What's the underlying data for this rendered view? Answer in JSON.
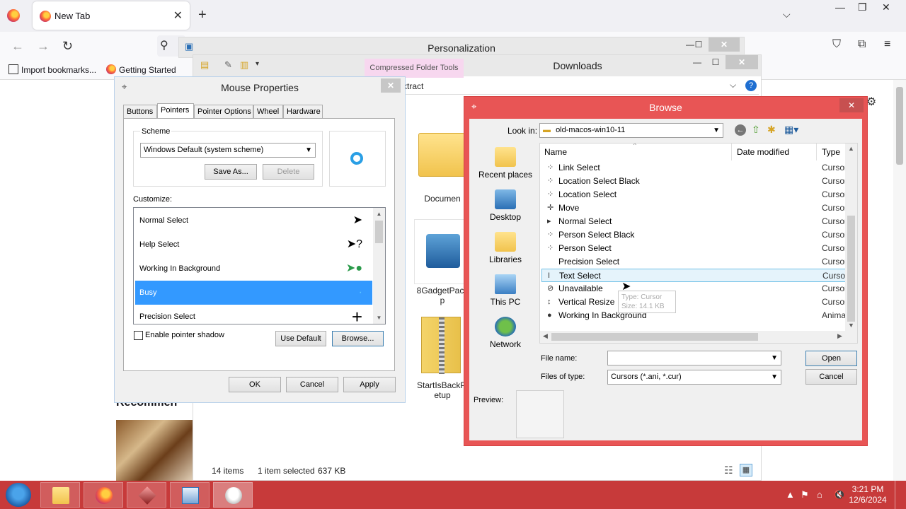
{
  "firefox": {
    "tab_title": "New Tab",
    "new_tab_glyph": "+",
    "bookmarks": [
      "Import bookmarks...",
      "Getting Started"
    ]
  },
  "webpage": {
    "section_heading": "Recommen"
  },
  "personalization": {
    "title": "Personalization"
  },
  "downloads": {
    "title": "Downloads",
    "context_tab": "Compressed Folder Tools",
    "address_text": "xtract",
    "files": [
      {
        "label": "Documen"
      },
      {
        "label": "8GadgetPack\np"
      },
      {
        "label": "StartIsBackPl\netup"
      }
    ],
    "status_items": "14 items",
    "status_selected": "1 item selected",
    "status_size": "637 KB"
  },
  "mouse_properties": {
    "title": "Mouse Properties",
    "tabs": [
      "Buttons",
      "Pointers",
      "Pointer Options",
      "Wheel",
      "Hardware"
    ],
    "active_tab": "Pointers",
    "scheme_label": "Scheme",
    "scheme_value": "Windows Default (system scheme)",
    "save_as": "Save As...",
    "delete": "Delete",
    "customize_label": "Customize:",
    "cursors": [
      {
        "name": "Normal Select",
        "glyph": "🡥"
      },
      {
        "name": "Help Select",
        "glyph": "?"
      },
      {
        "name": "Working In Background",
        "glyph": "●"
      },
      {
        "name": "Busy",
        "glyph": "·"
      },
      {
        "name": "Precision Select",
        "glyph": "+"
      }
    ],
    "selected_cursor": "Busy",
    "enable_shadow": "Enable pointer shadow",
    "use_default": "Use Default",
    "browse": "Browse...",
    "ok": "OK",
    "cancel": "Cancel",
    "apply": "Apply"
  },
  "browse_dialog": {
    "title": "Browse",
    "look_in_label": "Look in:",
    "look_in_value": "old-macos-win10-11",
    "places": [
      "Recent places",
      "Desktop",
      "Libraries",
      "This PC",
      "Network"
    ],
    "columns": {
      "name": "Name",
      "date": "Date modified",
      "type": "Type"
    },
    "files": [
      {
        "name": "Link Select",
        "type": "Cursor",
        "icon": "⁘"
      },
      {
        "name": "Location Select Black",
        "type": "Cursor",
        "icon": "⁘"
      },
      {
        "name": "Location Select",
        "type": "Cursor",
        "icon": "⁘"
      },
      {
        "name": "Move",
        "type": "Cursor",
        "icon": "✛"
      },
      {
        "name": "Normal Select",
        "type": "Cursor",
        "icon": "▸"
      },
      {
        "name": "Person Select Black",
        "type": "Cursor",
        "icon": "⁘"
      },
      {
        "name": "Person Select",
        "type": "Cursor",
        "icon": "⁘"
      },
      {
        "name": "Precision Select",
        "type": "Cursor",
        "icon": ""
      },
      {
        "name": "Text Select",
        "type": "Cursor",
        "icon": "I"
      },
      {
        "name": "Unavailable",
        "type": "Cursor",
        "icon": "⊘"
      },
      {
        "name": "Vertical Resize",
        "type": "Cursor",
        "icon": "↕"
      },
      {
        "name": "Working In Background",
        "type": "Anima",
        "icon": "●"
      }
    ],
    "selected_file": "Text Select",
    "tooltip_line1": "Type: Cursor",
    "tooltip_line2": "Size: 14.1 KB",
    "file_name_label": "File name:",
    "file_name_value": "",
    "files_of_type_label": "Files of type:",
    "files_of_type_value": "Cursors (*.ani, *.cur)",
    "open": "Open",
    "cancel": "Cancel",
    "preview_label": "Preview:"
  },
  "taskbar": {
    "time": "3:21 PM",
    "date": "12/6/2024"
  },
  "colors": {
    "taskbar": "#c73a3a",
    "browse_frame": "#e85555",
    "selection": "#3399ff"
  }
}
